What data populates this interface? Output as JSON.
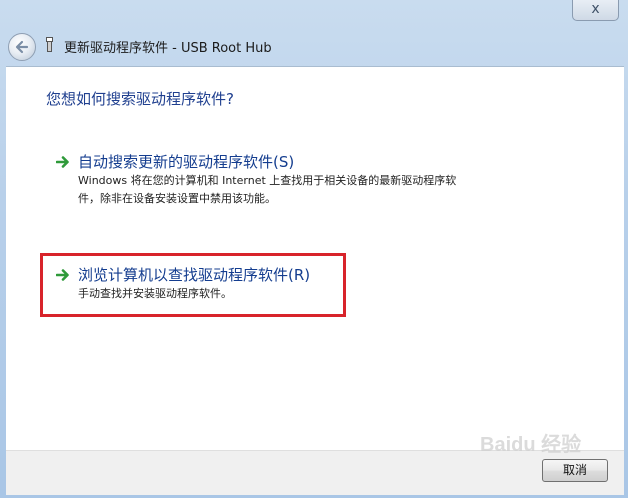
{
  "window": {
    "title": "更新驱动程序软件 - USB Root Hub",
    "close_label": "x"
  },
  "main": {
    "heading": "您想如何搜索驱动程序软件?",
    "options": [
      {
        "title": "自动搜索更新的驱动程序软件(S)",
        "desc_line1": "Windows 将在您的计算机和 Internet 上查找用于相关设备的最新驱动程序软",
        "desc_line2": "件，除非在设备安装设置中禁用该功能。"
      },
      {
        "title": "浏览计算机以查找驱动程序软件(R)",
        "desc_line1": "手动查找并安装驱动程序软件。"
      }
    ]
  },
  "footer": {
    "cancel_label": "取消"
  },
  "watermark": "Baidu 经验",
  "colors": {
    "heading": "#1f3f8f",
    "option_title": "#143d8f",
    "arrow": "#2f9a3a",
    "highlight": "#d8232a"
  }
}
